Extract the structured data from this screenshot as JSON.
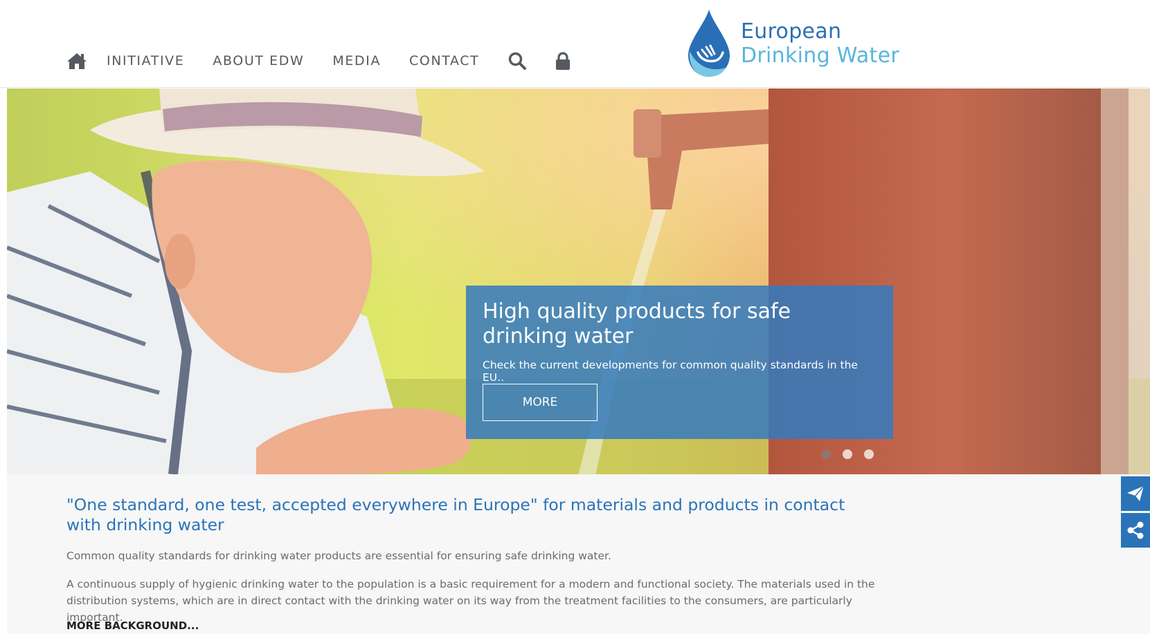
{
  "nav": {
    "items": [
      {
        "label": "INITIATIVE"
      },
      {
        "label": "ABOUT EDW"
      },
      {
        "label": "MEDIA"
      },
      {
        "label": "CONTACT"
      }
    ],
    "icons": [
      "home-icon",
      "search-icon",
      "lock-icon"
    ],
    "color": "#555a60"
  },
  "logo": {
    "line1": "European",
    "line2": "Drinking Water"
  },
  "hero": {
    "title": "High quality products for safe drinking water",
    "subtitle": "Check the current developments for common quality standards in the EU..",
    "button": "MORE",
    "slides": 3,
    "active_slide": 1,
    "caption_color": "#347abe"
  },
  "content": {
    "heading": "\"One standard, one test, accepted everywhere in Europe\" for materials and products in contact with drinking water",
    "para1": "Common quality standards for drinking water products are essential for ensuring safe drinking water.",
    "para2": "A continuous supply of hygienic drinking water to the population is a basic requirement for a modern and functional society. The materials used in the distribution systems, which are in direct contact with the drinking water on its way from the treatment facilities to the consumers, are particularly important.",
    "more_link": "MORE BACKGROUND..."
  },
  "side_buttons": [
    "send-icon",
    "share-icon"
  ],
  "colors": {
    "brand_blue": "#2a73b8",
    "brand_light_blue": "#58b5dd"
  }
}
